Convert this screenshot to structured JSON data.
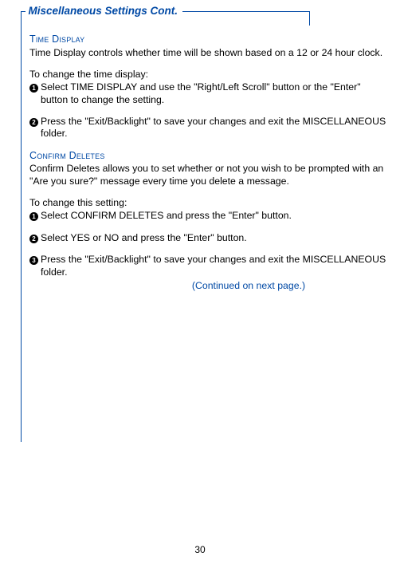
{
  "header": {
    "title": "Miscellaneous Settings Cont."
  },
  "sections": {
    "time": {
      "heading": "Time Display",
      "intro": "Time Display controls whether time will be shown based on a 12 or 24 hour clock.",
      "leadin": "To change the time display:",
      "step1": "Select TIME DISPLAY and use the \"Right/Left Scroll\" button or the \"Enter\" button to change the setting.",
      "step2": "Press the \"Exit/Backlight\" to save your changes and exit the MISCELLANEOUS folder."
    },
    "confirm": {
      "heading": "Confirm Deletes",
      "intro": "Confirm Deletes allows you to set whether or not you wish to be prompted with an \"Are you sure?\" message every time you delete a message.",
      "leadin": "To change this setting:",
      "step1": "Select CONFIRM DELETES and press the \"Enter\" button.",
      "step2": "Select YES or NO and press the \"Enter\" button.",
      "step3": "Press the \"Exit/Backlight\" to save your changes and exit the MISCELLANEOUS folder."
    }
  },
  "continued": "(Continued on next page.)",
  "page_number": "30"
}
